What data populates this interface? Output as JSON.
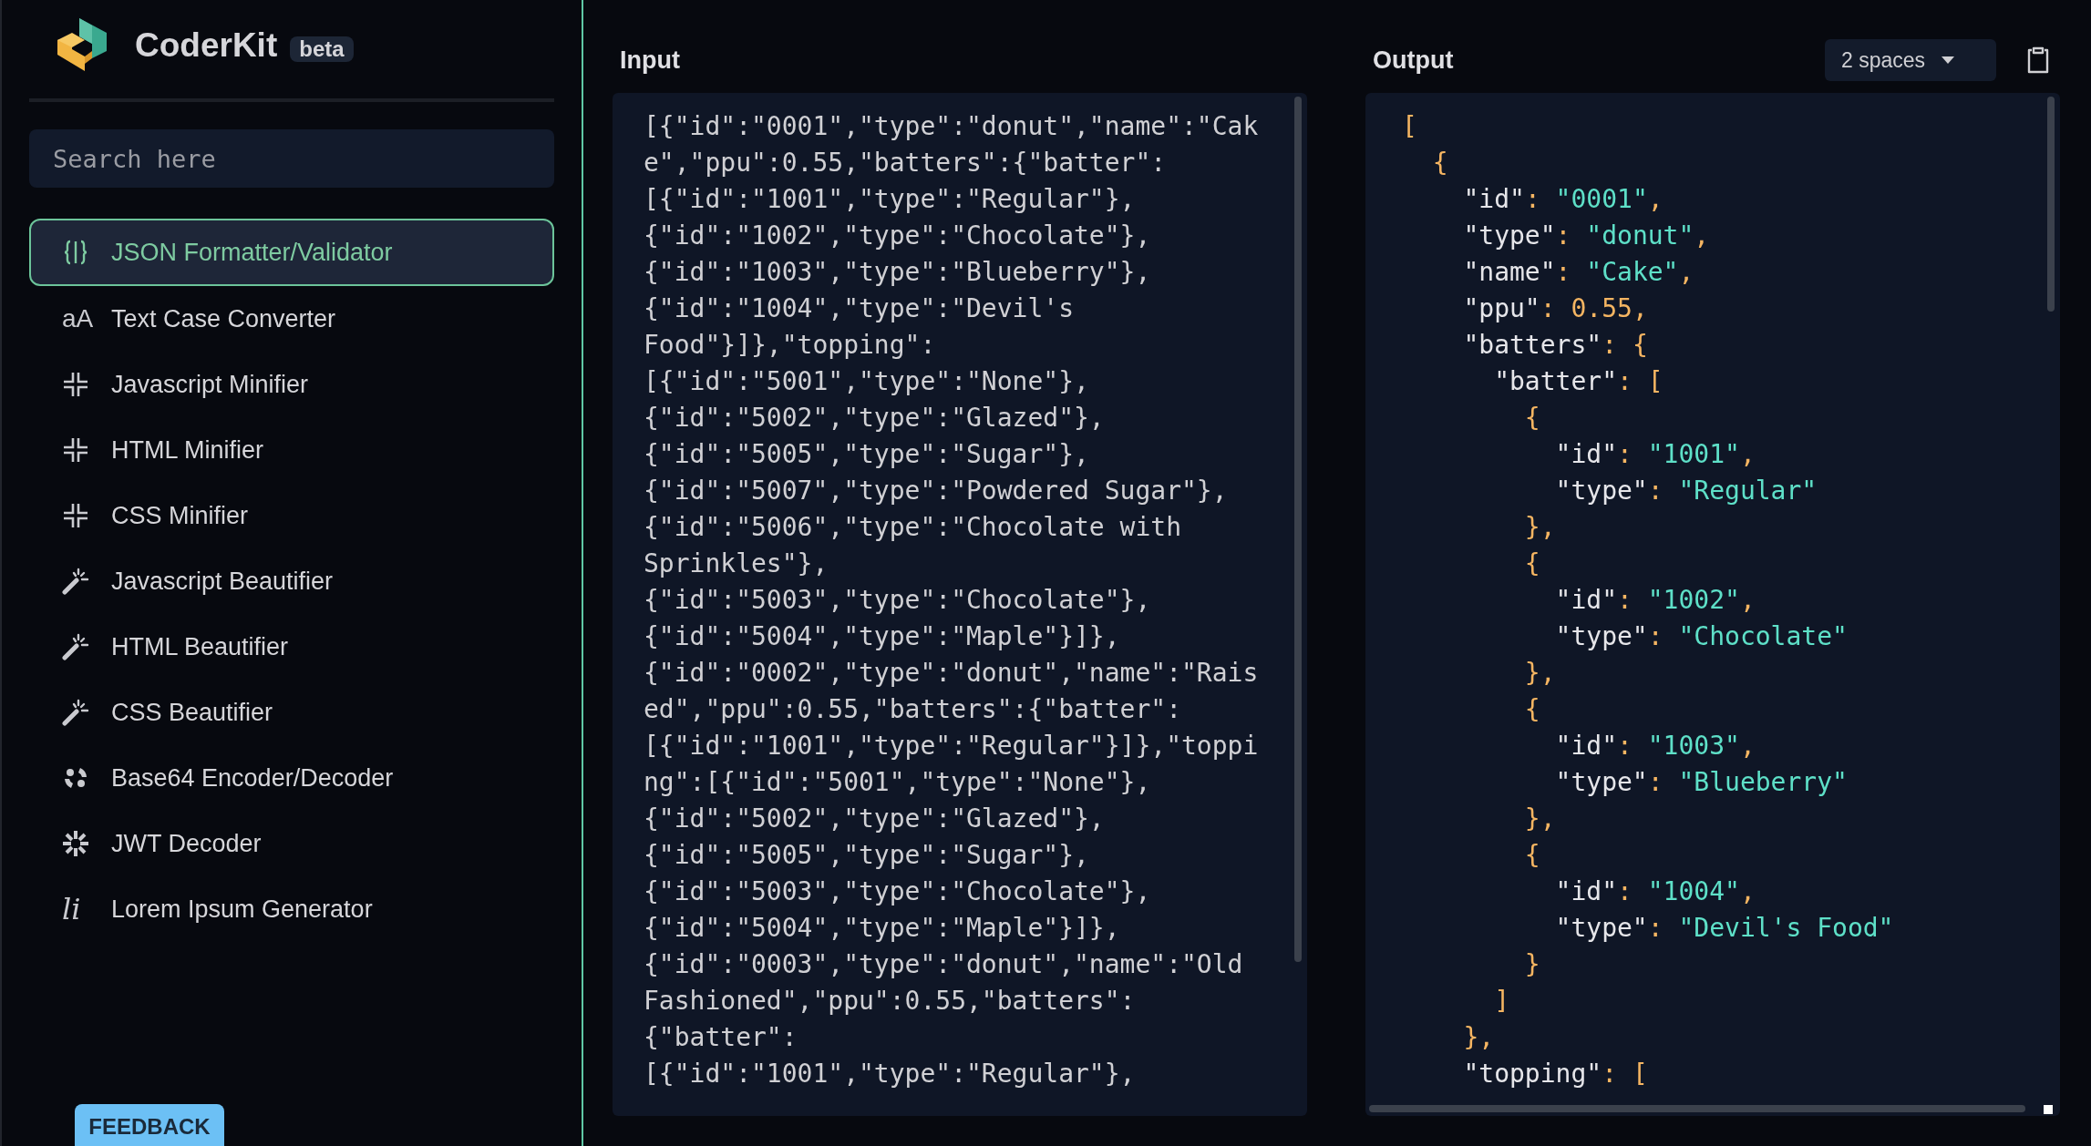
{
  "brand": {
    "name": "CoderKit",
    "badge": "beta"
  },
  "search": {
    "placeholder": "Search here"
  },
  "sidebar": {
    "items": [
      {
        "kind": "braces",
        "label": "JSON Formatter/Validator",
        "selected": true
      },
      {
        "kind": "glyph",
        "glyph": "aA",
        "label": "Text Case Converter",
        "selected": false
      },
      {
        "kind": "minify",
        "label": "Javascript Minifier",
        "selected": false
      },
      {
        "kind": "minify",
        "label": "HTML Minifier",
        "selected": false
      },
      {
        "kind": "minify",
        "label": "CSS Minifier",
        "selected": false
      },
      {
        "kind": "wand",
        "label": "Javascript Beautifier",
        "selected": false
      },
      {
        "kind": "wand",
        "label": "HTML Beautifier",
        "selected": false
      },
      {
        "kind": "wand",
        "label": "CSS Beautifier",
        "selected": false
      },
      {
        "kind": "dots",
        "label": "Base64 Encoder/Decoder",
        "selected": false
      },
      {
        "kind": "burst",
        "label": "JWT Decoder",
        "selected": false
      },
      {
        "kind": "glyph",
        "glyph": "li",
        "label": "Lorem Ipsum Generator",
        "selected": false
      }
    ]
  },
  "feedback": {
    "label": "FEEDBACK"
  },
  "input": {
    "title": "Input",
    "value": "[{\"id\":\"0001\",\"type\":\"donut\",\"name\":\"Cake\",\"ppu\":0.55,\"batters\":{\"batter\":[{\"id\":\"1001\",\"type\":\"Regular\"},{\"id\":\"1002\",\"type\":\"Chocolate\"},{\"id\":\"1003\",\"type\":\"Blueberry\"},{\"id\":\"1004\",\"type\":\"Devil's Food\"}]},\"topping\":[{\"id\":\"5001\",\"type\":\"None\"},{\"id\":\"5002\",\"type\":\"Glazed\"},{\"id\":\"5005\",\"type\":\"Sugar\"},{\"id\":\"5007\",\"type\":\"Powdered Sugar\"},{\"id\":\"5006\",\"type\":\"Chocolate with Sprinkles\"},{\"id\":\"5003\",\"type\":\"Chocolate\"},{\"id\":\"5004\",\"type\":\"Maple\"}]},{\"id\":\"0002\",\"type\":\"donut\",\"name\":\"Raised\",\"ppu\":0.55,\"batters\":{\"batter\":[{\"id\":\"1001\",\"type\":\"Regular\"}]},\"topping\":[{\"id\":\"5001\",\"type\":\"None\"},{\"id\":\"5002\",\"type\":\"Glazed\"},{\"id\":\"5005\",\"type\":\"Sugar\"},{\"id\":\"5003\",\"type\":\"Chocolate\"},{\"id\":\"5004\",\"type\":\"Maple\"}]},{\"id\":\"0003\",\"type\":\"donut\",\"name\":\"Old Fashioned\",\"ppu\":0.55,\"batters\":{\"batter\":[{\"id\":\"1001\",\"type\":\"Regular\"},"
  },
  "output": {
    "title": "Output",
    "indent": "2 spaces",
    "lines": [
      "[",
      "  {",
      "    \"id\": \"0001\",",
      "    \"type\": \"donut\",",
      "    \"name\": \"Cake\",",
      "    \"ppu\": 0.55,",
      "    \"batters\": {",
      "      \"batter\": [",
      "        {",
      "          \"id\": \"1001\",",
      "          \"type\": \"Regular\"",
      "        },",
      "        {",
      "          \"id\": \"1002\",",
      "          \"type\": \"Chocolate\"",
      "        },",
      "        {",
      "          \"id\": \"1003\",",
      "          \"type\": \"Blueberry\"",
      "        },",
      "        {",
      "          \"id\": \"1004\",",
      "          \"type\": \"Devil's Food\"",
      "        }",
      "      ]",
      "    },",
      "    \"topping\": ["
    ]
  }
}
